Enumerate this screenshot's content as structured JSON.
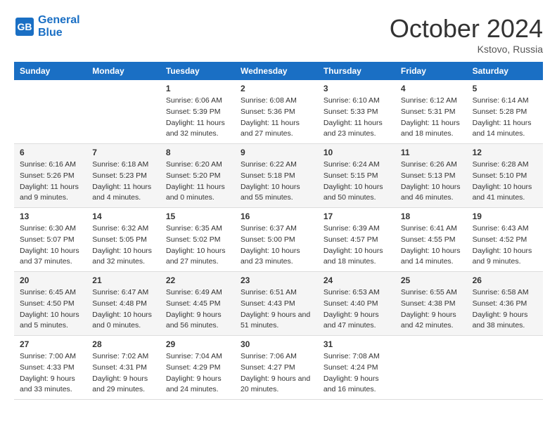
{
  "header": {
    "logo_line1": "General",
    "logo_line2": "Blue",
    "month": "October 2024",
    "location": "Kstovo, Russia"
  },
  "weekdays": [
    "Sunday",
    "Monday",
    "Tuesday",
    "Wednesday",
    "Thursday",
    "Friday",
    "Saturday"
  ],
  "weeks": [
    [
      {
        "day": "",
        "detail": ""
      },
      {
        "day": "",
        "detail": ""
      },
      {
        "day": "1",
        "detail": "Sunrise: 6:06 AM\nSunset: 5:39 PM\nDaylight: 11 hours and 32 minutes."
      },
      {
        "day": "2",
        "detail": "Sunrise: 6:08 AM\nSunset: 5:36 PM\nDaylight: 11 hours and 27 minutes."
      },
      {
        "day": "3",
        "detail": "Sunrise: 6:10 AM\nSunset: 5:33 PM\nDaylight: 11 hours and 23 minutes."
      },
      {
        "day": "4",
        "detail": "Sunrise: 6:12 AM\nSunset: 5:31 PM\nDaylight: 11 hours and 18 minutes."
      },
      {
        "day": "5",
        "detail": "Sunrise: 6:14 AM\nSunset: 5:28 PM\nDaylight: 11 hours and 14 minutes."
      }
    ],
    [
      {
        "day": "6",
        "detail": "Sunrise: 6:16 AM\nSunset: 5:26 PM\nDaylight: 11 hours and 9 minutes."
      },
      {
        "day": "7",
        "detail": "Sunrise: 6:18 AM\nSunset: 5:23 PM\nDaylight: 11 hours and 4 minutes."
      },
      {
        "day": "8",
        "detail": "Sunrise: 6:20 AM\nSunset: 5:20 PM\nDaylight: 11 hours and 0 minutes."
      },
      {
        "day": "9",
        "detail": "Sunrise: 6:22 AM\nSunset: 5:18 PM\nDaylight: 10 hours and 55 minutes."
      },
      {
        "day": "10",
        "detail": "Sunrise: 6:24 AM\nSunset: 5:15 PM\nDaylight: 10 hours and 50 minutes."
      },
      {
        "day": "11",
        "detail": "Sunrise: 6:26 AM\nSunset: 5:13 PM\nDaylight: 10 hours and 46 minutes."
      },
      {
        "day": "12",
        "detail": "Sunrise: 6:28 AM\nSunset: 5:10 PM\nDaylight: 10 hours and 41 minutes."
      }
    ],
    [
      {
        "day": "13",
        "detail": "Sunrise: 6:30 AM\nSunset: 5:07 PM\nDaylight: 10 hours and 37 minutes."
      },
      {
        "day": "14",
        "detail": "Sunrise: 6:32 AM\nSunset: 5:05 PM\nDaylight: 10 hours and 32 minutes."
      },
      {
        "day": "15",
        "detail": "Sunrise: 6:35 AM\nSunset: 5:02 PM\nDaylight: 10 hours and 27 minutes."
      },
      {
        "day": "16",
        "detail": "Sunrise: 6:37 AM\nSunset: 5:00 PM\nDaylight: 10 hours and 23 minutes."
      },
      {
        "day": "17",
        "detail": "Sunrise: 6:39 AM\nSunset: 4:57 PM\nDaylight: 10 hours and 18 minutes."
      },
      {
        "day": "18",
        "detail": "Sunrise: 6:41 AM\nSunset: 4:55 PM\nDaylight: 10 hours and 14 minutes."
      },
      {
        "day": "19",
        "detail": "Sunrise: 6:43 AM\nSunset: 4:52 PM\nDaylight: 10 hours and 9 minutes."
      }
    ],
    [
      {
        "day": "20",
        "detail": "Sunrise: 6:45 AM\nSunset: 4:50 PM\nDaylight: 10 hours and 5 minutes."
      },
      {
        "day": "21",
        "detail": "Sunrise: 6:47 AM\nSunset: 4:48 PM\nDaylight: 10 hours and 0 minutes."
      },
      {
        "day": "22",
        "detail": "Sunrise: 6:49 AM\nSunset: 4:45 PM\nDaylight: 9 hours and 56 minutes."
      },
      {
        "day": "23",
        "detail": "Sunrise: 6:51 AM\nSunset: 4:43 PM\nDaylight: 9 hours and 51 minutes."
      },
      {
        "day": "24",
        "detail": "Sunrise: 6:53 AM\nSunset: 4:40 PM\nDaylight: 9 hours and 47 minutes."
      },
      {
        "day": "25",
        "detail": "Sunrise: 6:55 AM\nSunset: 4:38 PM\nDaylight: 9 hours and 42 minutes."
      },
      {
        "day": "26",
        "detail": "Sunrise: 6:58 AM\nSunset: 4:36 PM\nDaylight: 9 hours and 38 minutes."
      }
    ],
    [
      {
        "day": "27",
        "detail": "Sunrise: 7:00 AM\nSunset: 4:33 PM\nDaylight: 9 hours and 33 minutes."
      },
      {
        "day": "28",
        "detail": "Sunrise: 7:02 AM\nSunset: 4:31 PM\nDaylight: 9 hours and 29 minutes."
      },
      {
        "day": "29",
        "detail": "Sunrise: 7:04 AM\nSunset: 4:29 PM\nDaylight: 9 hours and 24 minutes."
      },
      {
        "day": "30",
        "detail": "Sunrise: 7:06 AM\nSunset: 4:27 PM\nDaylight: 9 hours and 20 minutes."
      },
      {
        "day": "31",
        "detail": "Sunrise: 7:08 AM\nSunset: 4:24 PM\nDaylight: 9 hours and 16 minutes."
      },
      {
        "day": "",
        "detail": ""
      },
      {
        "day": "",
        "detail": ""
      }
    ]
  ]
}
